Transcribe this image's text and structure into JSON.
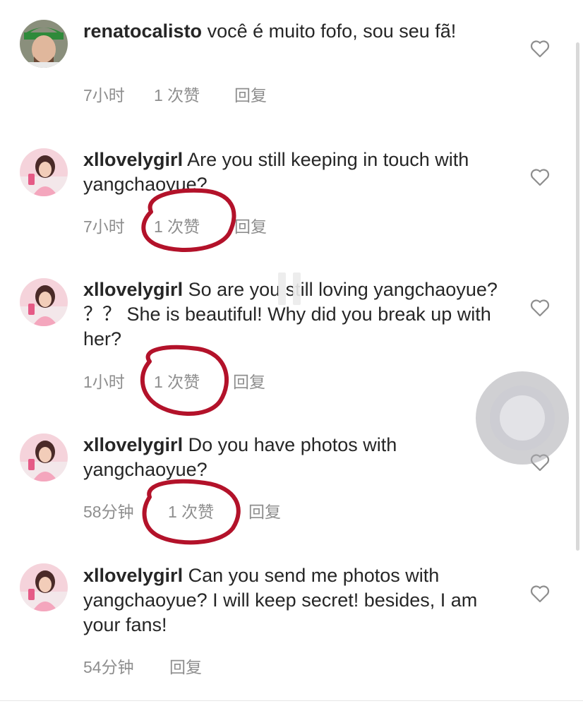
{
  "comments": [
    {
      "username": "renatocalisto",
      "text": "você é muito fofo, sou seu fã!",
      "time": "7小时",
      "likes": "1 次赞",
      "reply": "回复"
    },
    {
      "username": "xllovelygirl",
      "text": "Are you still keeping in touch with yangchaoyue?",
      "time": "7小时",
      "likes": "1 次赞",
      "reply": "回复"
    },
    {
      "username": "xllovelygirl",
      "text": "So are you still loving yangchaoyue? ？？ She is beautiful! Why did you break up with her?",
      "time": "1小时",
      "likes": "1 次赞",
      "reply": "回复"
    },
    {
      "username": "xllovelygirl",
      "text": "Do you have photos with yangchaoyue?",
      "time": "58分钟",
      "likes": "1 次赞",
      "reply": "回复"
    },
    {
      "username": "xllovelygirl",
      "text": "Can you send me photos with yangchaoyue? I will keep secret! besides, I am your fans!",
      "time": "54分钟",
      "reply": "回复"
    }
  ],
  "icons": {
    "like": "heart-icon",
    "floating_button": "assistive-touch-icon",
    "video_overlay": "pause-icon"
  },
  "colors": {
    "text": "#262626",
    "meta": "#8e8e8e",
    "annotation": "#b3122a"
  }
}
